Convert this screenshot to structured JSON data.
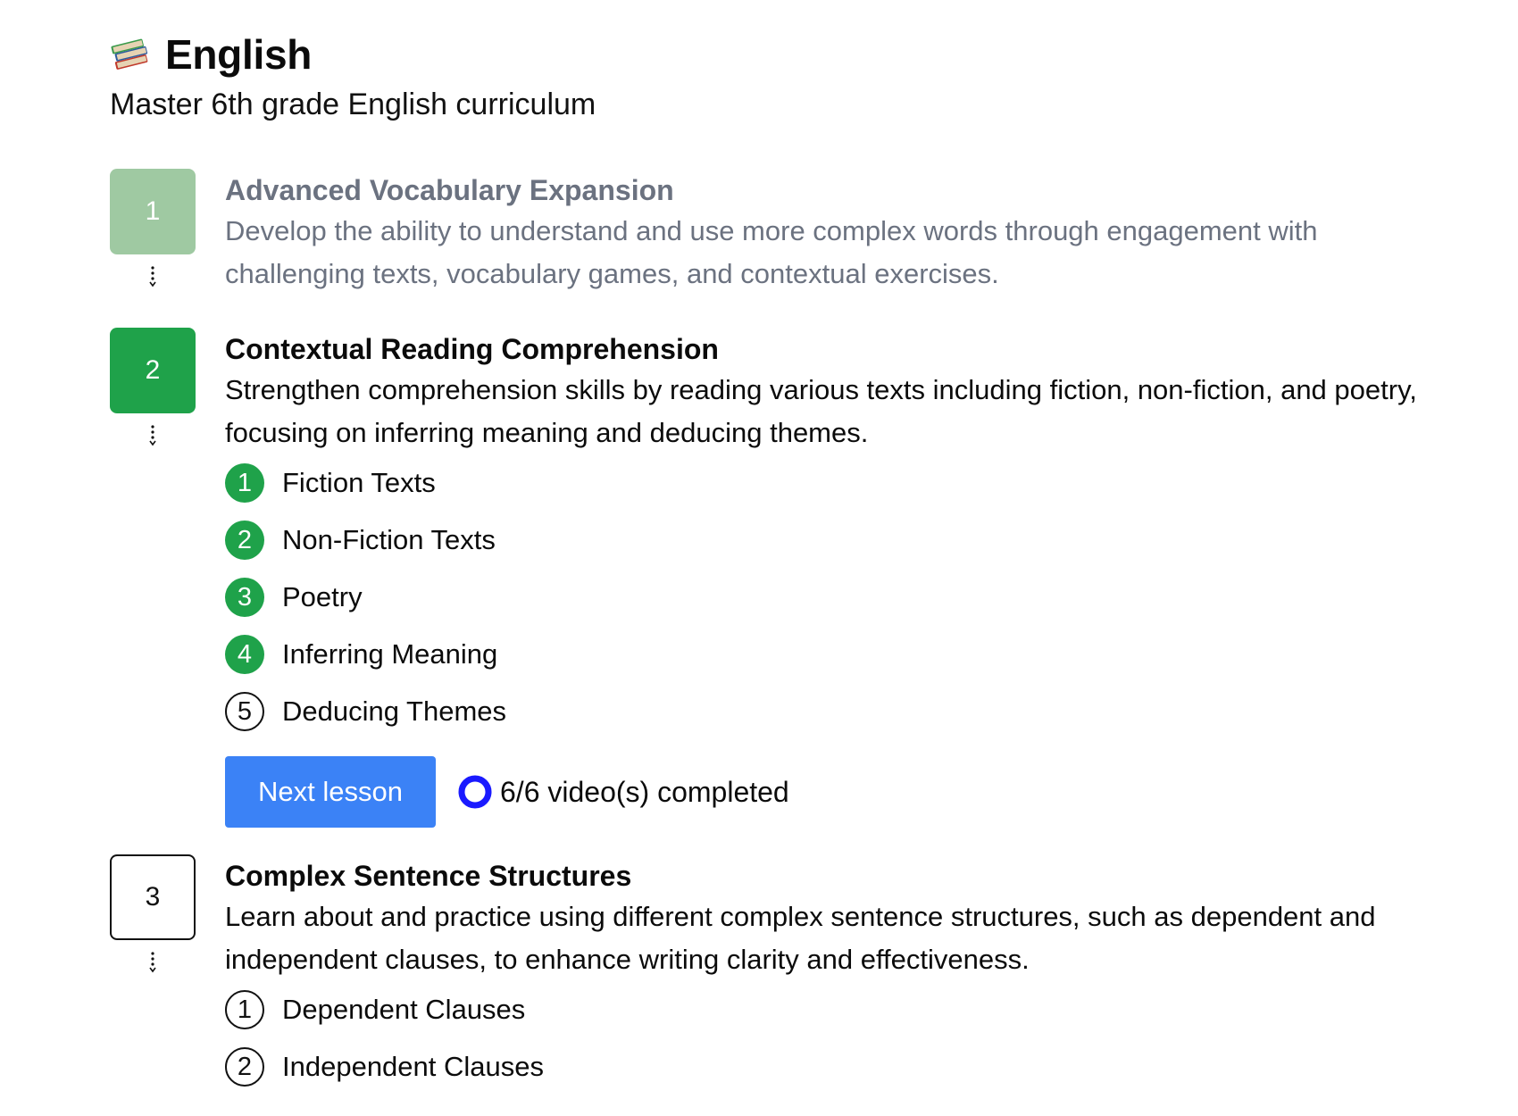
{
  "course": {
    "icon": "books-icon",
    "title": "English",
    "subtitle": "Master 6th grade English curriculum"
  },
  "units": [
    {
      "number": "1",
      "status": "completed",
      "title": "Advanced Vocabulary Expansion",
      "description": "Develop the ability to understand and use more complex words through engagement with challenging texts, vocabulary games, and contextual exercises."
    },
    {
      "number": "2",
      "status": "current",
      "title": "Contextual Reading Comprehension",
      "description": "Strengthen comprehension skills by reading various texts including fiction, non-fiction, and poetry, focusing on inferring meaning and deducing themes.",
      "lessons": [
        {
          "number": "1",
          "label": "Fiction Texts",
          "completed": true
        },
        {
          "number": "2",
          "label": "Non-Fiction Texts",
          "completed": true
        },
        {
          "number": "3",
          "label": "Poetry",
          "completed": true
        },
        {
          "number": "4",
          "label": "Inferring Meaning",
          "completed": true
        },
        {
          "number": "5",
          "label": "Deducing Themes",
          "completed": false
        }
      ],
      "next_button_label": "Next lesson",
      "progress_text": "6/6 video(s) completed"
    },
    {
      "number": "3",
      "status": "upcoming",
      "title": "Complex Sentence Structures",
      "description": "Learn about and practice using different complex sentence structures, such as dependent and independent clauses, to enhance writing clarity and effectiveness.",
      "lessons": [
        {
          "number": "1",
          "label": "Dependent Clauses",
          "completed": false
        },
        {
          "number": "2",
          "label": "Independent Clauses",
          "completed": false
        }
      ]
    }
  ],
  "colors": {
    "completed_unit": "#9fc9a2",
    "current_green": "#1fa24a",
    "button_blue": "#3b82f6",
    "progress_ring": "#1a1aff",
    "muted_text": "#6b7280"
  }
}
